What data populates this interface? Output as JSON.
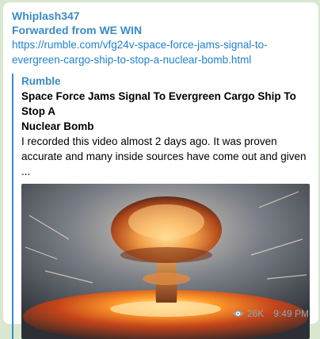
{
  "message": {
    "author": "Whiplash347",
    "forwarded": "Forwarded from WE WIN",
    "link_line1": "https://rumble.com/vfg24v-space-force-jams-signal-to-",
    "link_line2": "evergreen-cargo-ship-to-stop-a-nuclear-bomb.html"
  },
  "preview": {
    "site": "Rumble",
    "title_line1": "Space Force Jams Signal To Evergreen Cargo Ship To Stop A",
    "title_line2": "Nuclear Bomb",
    "desc_line1": "I recorded this video almost 2 days ago. It was proven",
    "desc_line2": "accurate and many inside sources have come out and given ..."
  },
  "footer": {
    "views": "26K",
    "time": "9:49 PM"
  },
  "colors": {
    "accent": "#3a8bc7",
    "link": "#2481cc",
    "meta": "#8fa6b8"
  }
}
